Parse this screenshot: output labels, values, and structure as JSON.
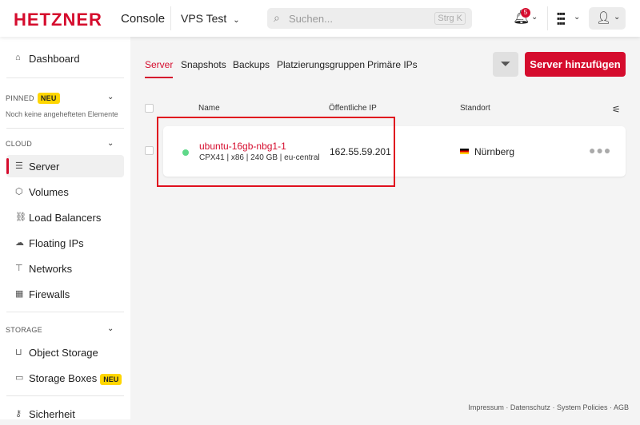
{
  "header": {
    "logo": "HETZNER",
    "app": "Console",
    "project": "VPS Test",
    "search_placeholder": "Suchen...",
    "search_shortcut": "Strg K",
    "notification_count": "5"
  },
  "sidebar": {
    "dashboard": "Dashboard",
    "pinned": {
      "title": "PINNED",
      "badge": "NEU",
      "empty": "Noch keine angehefteten Elemente"
    },
    "cloud": {
      "title": "CLOUD",
      "items": [
        "Server",
        "Volumes",
        "Load Balancers",
        "Floating IPs",
        "Networks",
        "Firewalls"
      ]
    },
    "storage": {
      "title": "STORAGE",
      "items": [
        "Object Storage",
        "Storage Boxes"
      ],
      "badge": "NEU"
    },
    "security": "Sicherheit"
  },
  "main": {
    "tabs": [
      "Server",
      "Snapshots",
      "Backups",
      "Platzierungsgruppen",
      "Primäre IPs"
    ],
    "add_button": "Server hinzufügen",
    "columns": [
      "Name",
      "Öffentliche IP",
      "Standort"
    ],
    "servers": [
      {
        "name": "ubuntu-16gb-nbg1-1",
        "desc": "CPX41 | x86 | 240 GB | eu-central",
        "ip": "162.55.59.201",
        "location": "Nürnberg",
        "status": "running"
      }
    ]
  },
  "footer": {
    "links": [
      "Impressum",
      "Datenschutz",
      "System Policies",
      "AGB"
    ]
  }
}
